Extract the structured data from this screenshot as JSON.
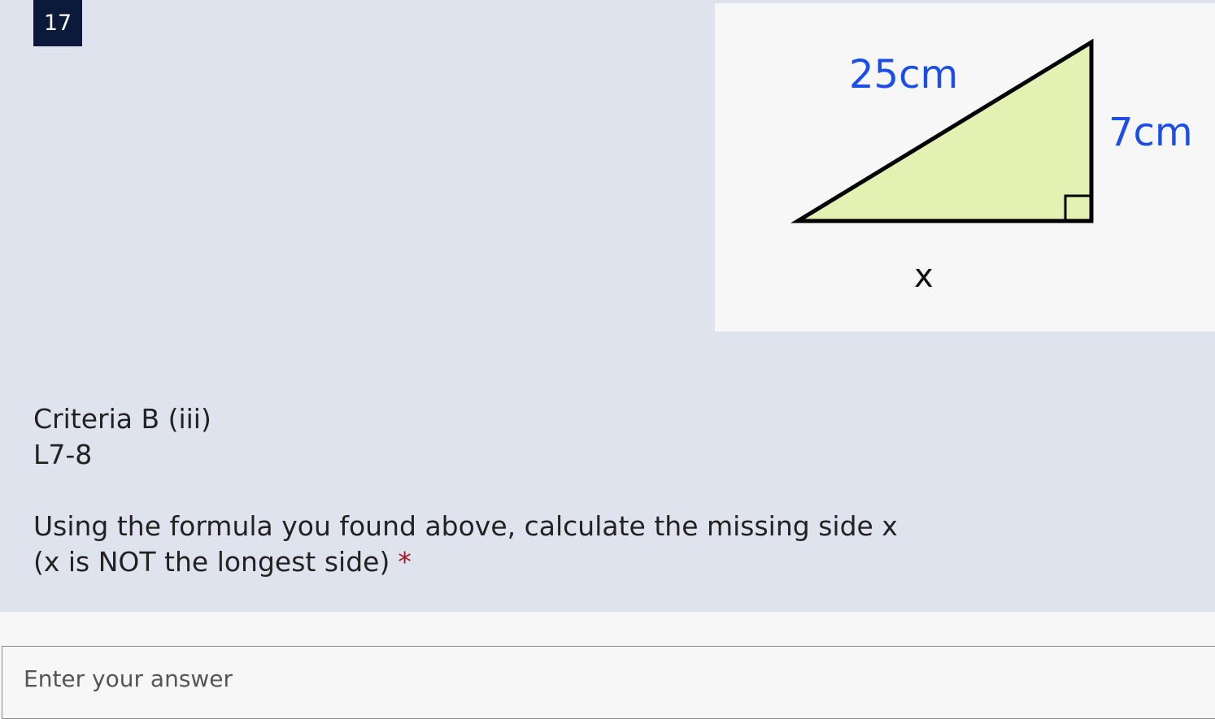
{
  "question": {
    "number": "17",
    "criteria_line1": "Criteria B (iii)",
    "criteria_line2": "L7-8",
    "prompt_line1": "Using the formula you found above, calculate the missing side x",
    "prompt_line2": "(x is NOT the longest side)",
    "required_marker": "*"
  },
  "diagram": {
    "hypotenuse_label": "25cm",
    "vertical_label": "7cm",
    "base_label": "x",
    "fill_color": "#e3f2b3",
    "label_color": "#1a4ee6"
  },
  "answer": {
    "placeholder": "Enter your answer",
    "value": ""
  }
}
